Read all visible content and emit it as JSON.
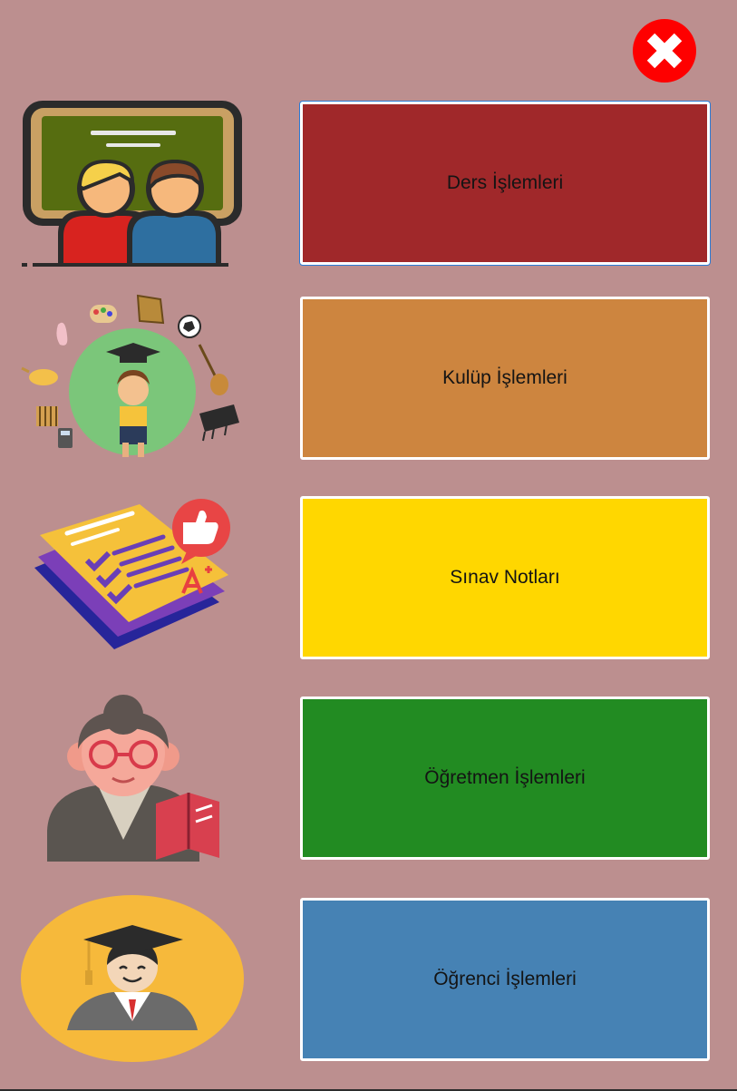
{
  "window": {
    "close_label": "close"
  },
  "menu": [
    {
      "label": "Ders İşlemleri",
      "color": "#a0282a",
      "icon": "classroom-students-icon"
    },
    {
      "label": "Kulüp İşlemleri",
      "color": "#cd853f",
      "icon": "club-activities-icon"
    },
    {
      "label": "Sınav Notları",
      "color": "#ffd700",
      "icon": "exam-paper-icon"
    },
    {
      "label": "Öğretmen İşlemleri",
      "color": "#228b22",
      "icon": "teacher-icon"
    },
    {
      "label": "Öğrenci İşlemleri",
      "color": "#4682b4",
      "icon": "graduate-student-icon"
    }
  ],
  "colors": {
    "background": "#bc8f8f",
    "close": "#fe0000"
  }
}
